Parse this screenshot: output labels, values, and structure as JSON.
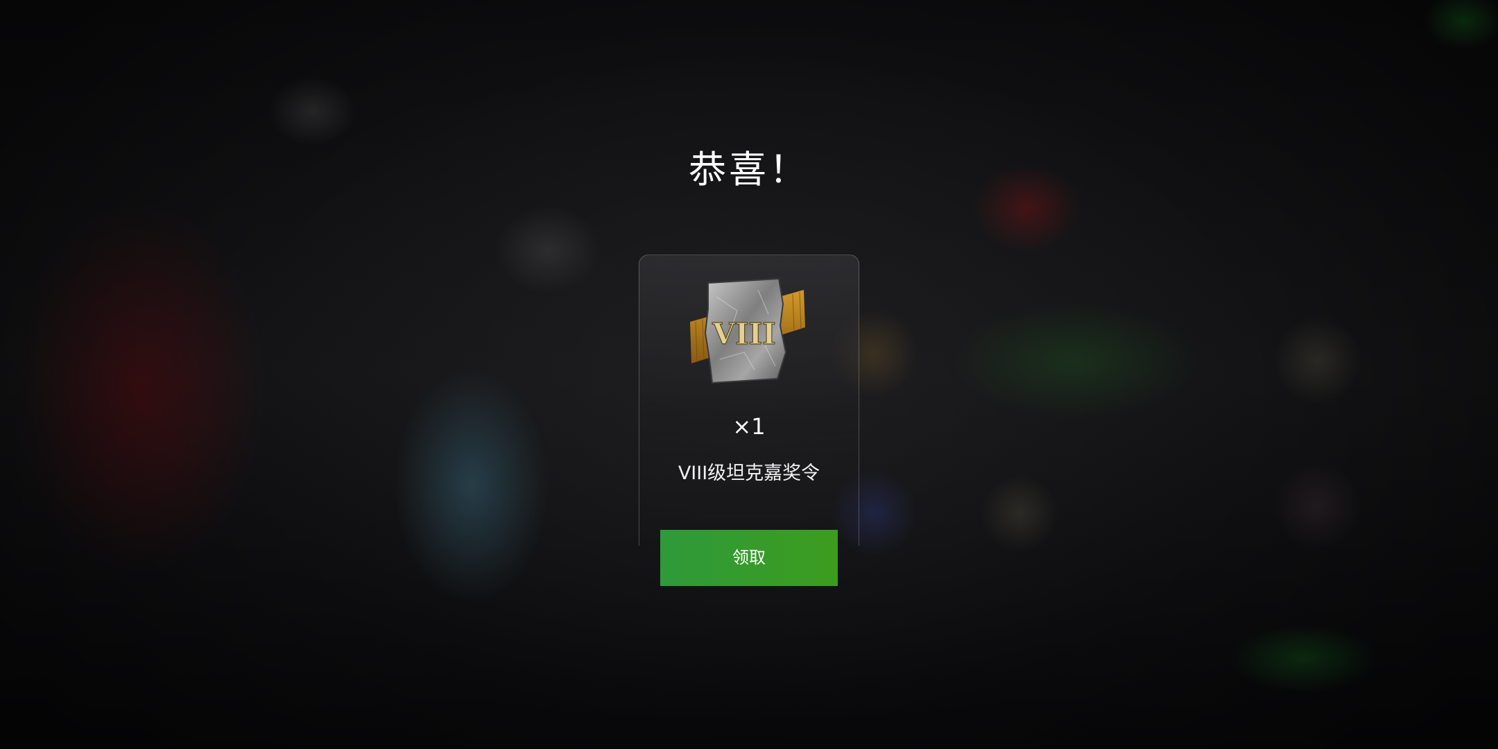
{
  "dialog": {
    "title": "恭喜！",
    "reward": {
      "icon": "tier-viii-tank-token-icon",
      "icon_text": "VIII",
      "quantity": "×1",
      "name": "VIII级坦克嘉奖令"
    },
    "claim_label": "领取"
  },
  "colors": {
    "button": "#34992c",
    "title": "#ffffff",
    "ribbon": "#b07a1c"
  }
}
